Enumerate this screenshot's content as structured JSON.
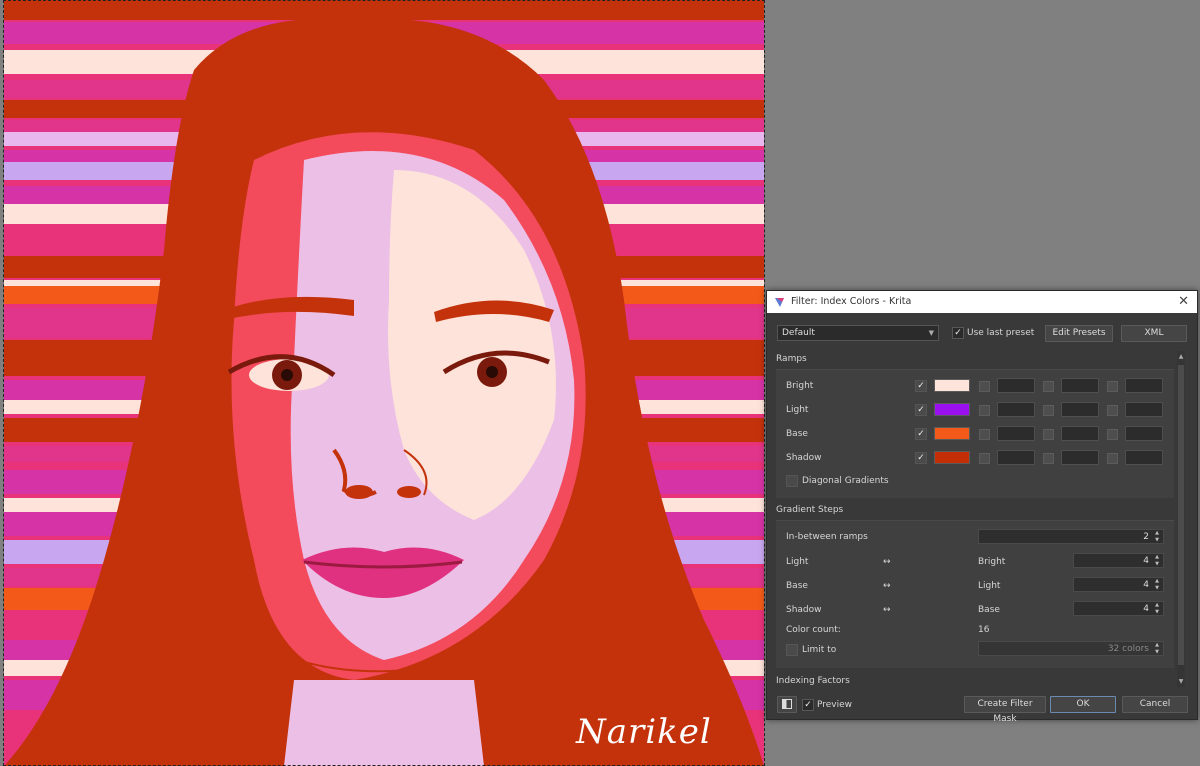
{
  "artwork": {
    "signature": "Narikel"
  },
  "dialog": {
    "title": "Filter: Index Colors - Krita",
    "preset_combo": "Default",
    "use_last_preset_label": "Use last preset",
    "edit_presets_label": "Edit Presets",
    "xml_label": "XML",
    "ramps_title": "Ramps",
    "ramps": [
      {
        "label": "Bright",
        "checked": "✓",
        "color": "#fde3d9"
      },
      {
        "label": "Light",
        "checked": "✓",
        "color": "#9b10ef"
      },
      {
        "label": "Base",
        "checked": "✓",
        "color": "#f35a1a"
      },
      {
        "label": "Shadow",
        "checked": "✓",
        "color": "#c42e07"
      }
    ],
    "diagonal_gradients_label": "Diagonal Gradients",
    "gradient_steps_title": "Gradient Steps",
    "in_between_label": "In-between ramps",
    "in_between_value": "2",
    "steps": [
      {
        "from": "Light",
        "arrow": "↔",
        "to": "Bright",
        "value": "4"
      },
      {
        "from": "Base",
        "arrow": "↔",
        "to": "Light",
        "value": "4"
      },
      {
        "from": "Shadow",
        "arrow": "↔",
        "to": "Base",
        "value": "4"
      }
    ],
    "color_count_label": "Color count:",
    "color_count_value": "16",
    "limit_to_label": "Limit to",
    "limit_to_value": "32 colors",
    "indexing_factors_title": "Indexing Factors",
    "preview_label": "Preview",
    "preview_checked": "✓",
    "create_filter_mask_label": "Create Filter Mask",
    "ok_label": "OK",
    "cancel_label": "Cancel"
  }
}
